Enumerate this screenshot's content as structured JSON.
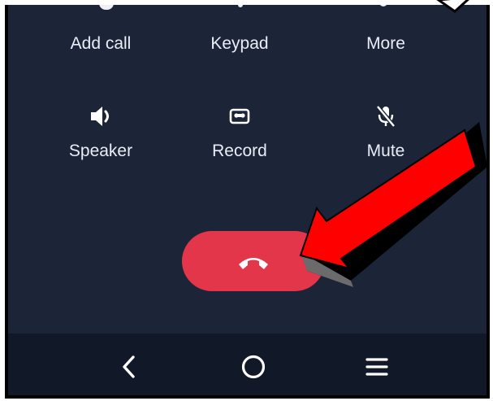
{
  "call_controls": {
    "row1": [
      {
        "label": "Add call",
        "icon": "add-call-icon"
      },
      {
        "label": "Keypad",
        "icon": "keypad-icon"
      },
      {
        "label": "More",
        "icon": "more-icon"
      }
    ],
    "row2": [
      {
        "label": "Speaker",
        "icon": "speaker-icon"
      },
      {
        "label": "Record",
        "icon": "record-icon"
      },
      {
        "label": "Mute",
        "icon": "mute-icon"
      }
    ]
  },
  "end_call": {
    "icon": "end-call-icon",
    "color": "#e3364a"
  },
  "navigation": {
    "buttons": [
      {
        "name": "back",
        "icon": "back-chevron-icon"
      },
      {
        "name": "home",
        "icon": "home-circle-icon"
      },
      {
        "name": "recents",
        "icon": "menu-lines-icon"
      }
    ]
  },
  "colors": {
    "screen_background": "#1c2438",
    "nav_background": "#111828",
    "text": "#e9edf5",
    "annotation_arrow": "#ff0000"
  },
  "annotation": {
    "type": "red-arrow",
    "points_to": "end-call-button"
  }
}
